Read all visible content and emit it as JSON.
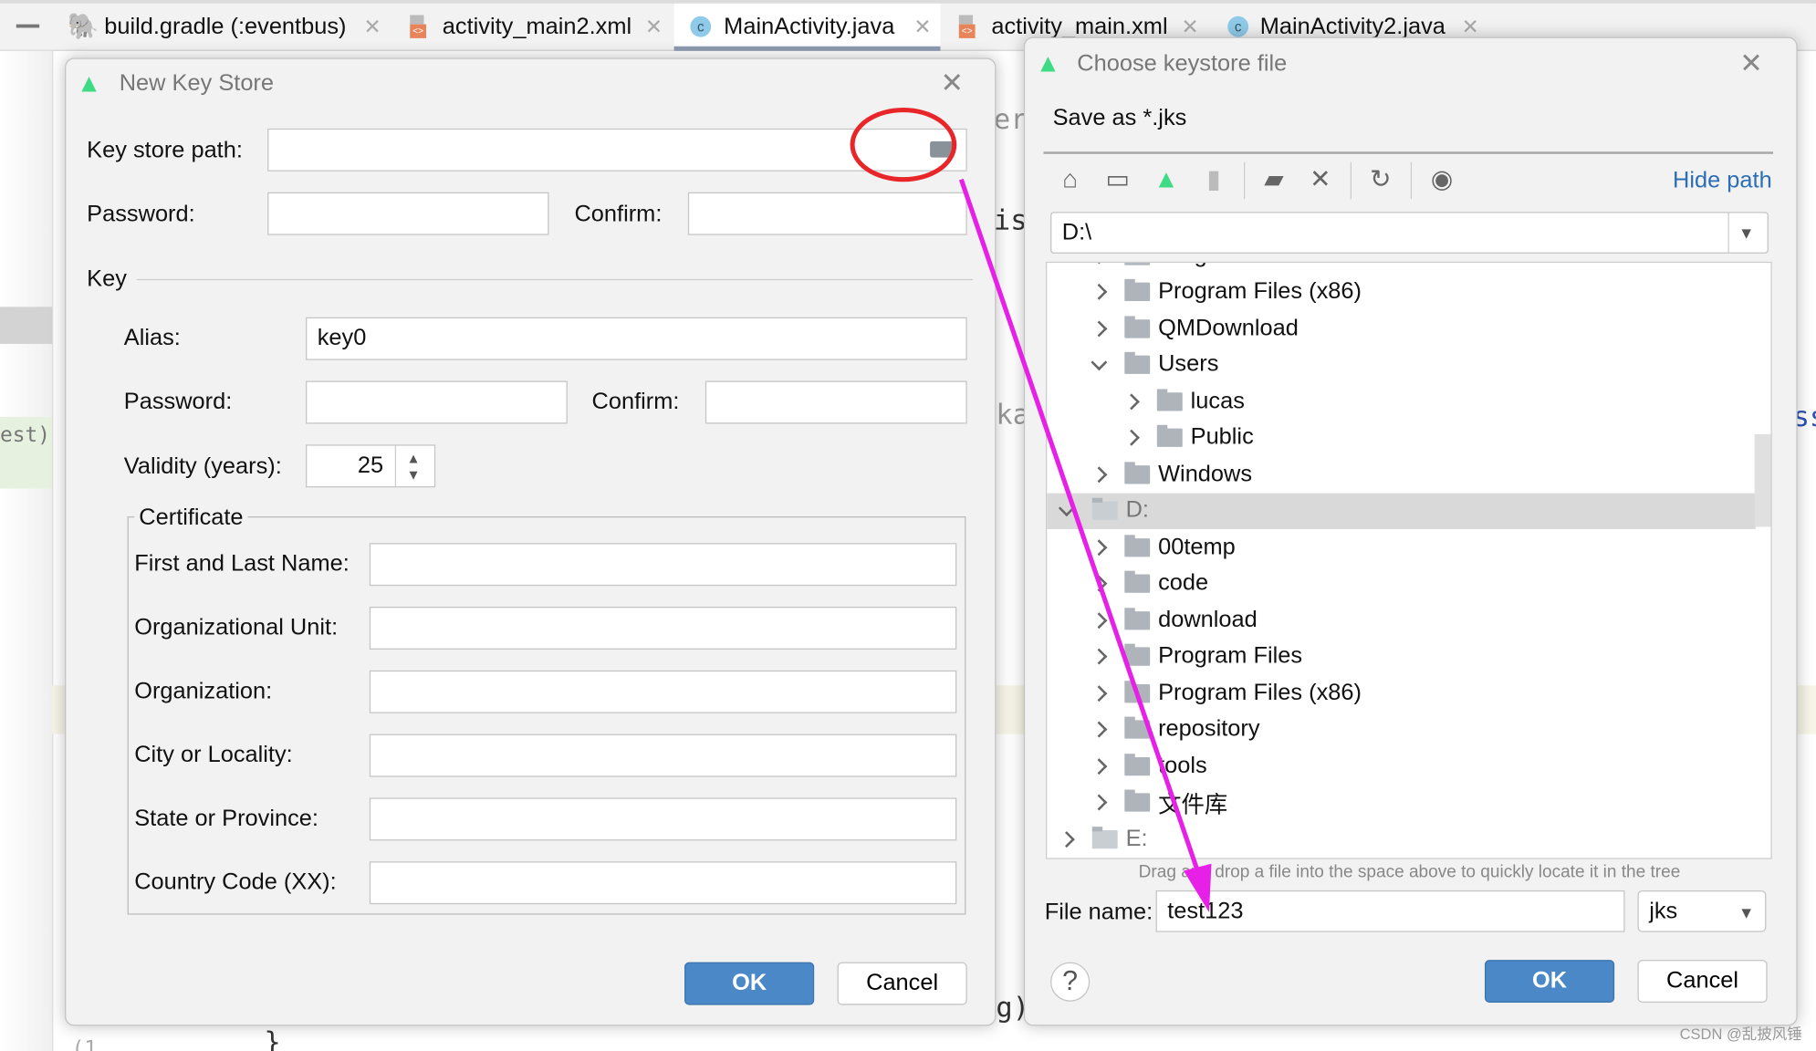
{
  "tabs": [
    {
      "label": "build.gradle (:eventbus)",
      "icon": "gradle-icon"
    },
    {
      "label": "activity_main2.xml",
      "icon": "xml-icon"
    },
    {
      "label": "MainActivity.java",
      "icon": "java-class-icon",
      "active": true
    },
    {
      "label": "activity_main.xml",
      "icon": "xml-icon"
    },
    {
      "label": "MainActivity2.java",
      "icon": "java-class-icon"
    }
  ],
  "editor": {
    "gutter_text": "est)",
    "fragments": [
      "er:",
      "is",
      "ka",
      "ss",
      "g)",
      "}",
      "(1"
    ]
  },
  "new_key_store": {
    "title": "New Key Store",
    "key_store_path_label": "Key store path:",
    "key_store_path_value": "",
    "password_label": "Password:",
    "confirm_label": "Confirm:",
    "key_section": "Key",
    "alias_label": "Alias:",
    "alias_value": "key0",
    "key_password_label": "Password:",
    "key_confirm_label": "Confirm:",
    "validity_label": "Validity (years):",
    "validity_value": "25",
    "certificate_section": "Certificate",
    "certificate_fields": [
      {
        "label": "First and Last Name:",
        "value": ""
      },
      {
        "label": "Organizational Unit:",
        "value": ""
      },
      {
        "label": "Organization:",
        "value": ""
      },
      {
        "label": "City or Locality:",
        "value": ""
      },
      {
        "label": "State or Province:",
        "value": ""
      },
      {
        "label": "Country Code (XX):",
        "value": ""
      }
    ],
    "ok_label": "OK",
    "cancel_label": "Cancel"
  },
  "chooser": {
    "title": "Choose keystore file",
    "subtitle": "Save as *.jks",
    "hide_path_label": "Hide path",
    "path_value": "D:\\",
    "toolbar_icons": [
      "home-icon",
      "desktop-icon",
      "android-project-icon",
      "module-icon",
      "new-folder-icon",
      "delete-icon",
      "refresh-icon",
      "show-hidden-icon"
    ],
    "tree": [
      {
        "label": "Program Files",
        "level": 1,
        "state": "collapsed",
        "partial": true
      },
      {
        "label": "Program Files (x86)",
        "level": 1,
        "state": "collapsed"
      },
      {
        "label": "QMDownload",
        "level": 1,
        "state": "collapsed"
      },
      {
        "label": "Users",
        "level": 1,
        "state": "expanded"
      },
      {
        "label": "lucas",
        "level": 2,
        "state": "collapsed"
      },
      {
        "label": "Public",
        "level": 2,
        "state": "collapsed"
      },
      {
        "label": "Windows",
        "level": 1,
        "state": "collapsed"
      },
      {
        "label": "D:",
        "level": 0,
        "state": "expanded",
        "selected": true,
        "drive": true
      },
      {
        "label": "00temp",
        "level": 1,
        "state": "collapsed"
      },
      {
        "label": "code",
        "level": 1,
        "state": "collapsed"
      },
      {
        "label": "download",
        "level": 1,
        "state": "collapsed"
      },
      {
        "label": "Program Files",
        "level": 1,
        "state": "collapsed"
      },
      {
        "label": "Program Files (x86)",
        "level": 1,
        "state": "collapsed"
      },
      {
        "label": "repository",
        "level": 1,
        "state": "collapsed"
      },
      {
        "label": "tools",
        "level": 1,
        "state": "collapsed"
      },
      {
        "label": "文件库",
        "level": 1,
        "state": "collapsed"
      },
      {
        "label": "E:",
        "level": 0,
        "state": "collapsed",
        "drive": true
      }
    ],
    "hint": "Drag and drop a file into the space above to quickly locate it in the tree",
    "file_name_label": "File name:",
    "file_name_value": "test123",
    "file_type_value": "jks",
    "help_label": "?",
    "ok_label": "OK",
    "cancel_label": "Cancel"
  },
  "annotations": {
    "highlight_color": "#e8262a",
    "arrow_color": "#e620e6"
  },
  "watermark": "CSDN @乱披风锤",
  "colors": {
    "accent": "#4a88c7",
    "link": "#2d6db5",
    "android": "#3ddc84"
  }
}
